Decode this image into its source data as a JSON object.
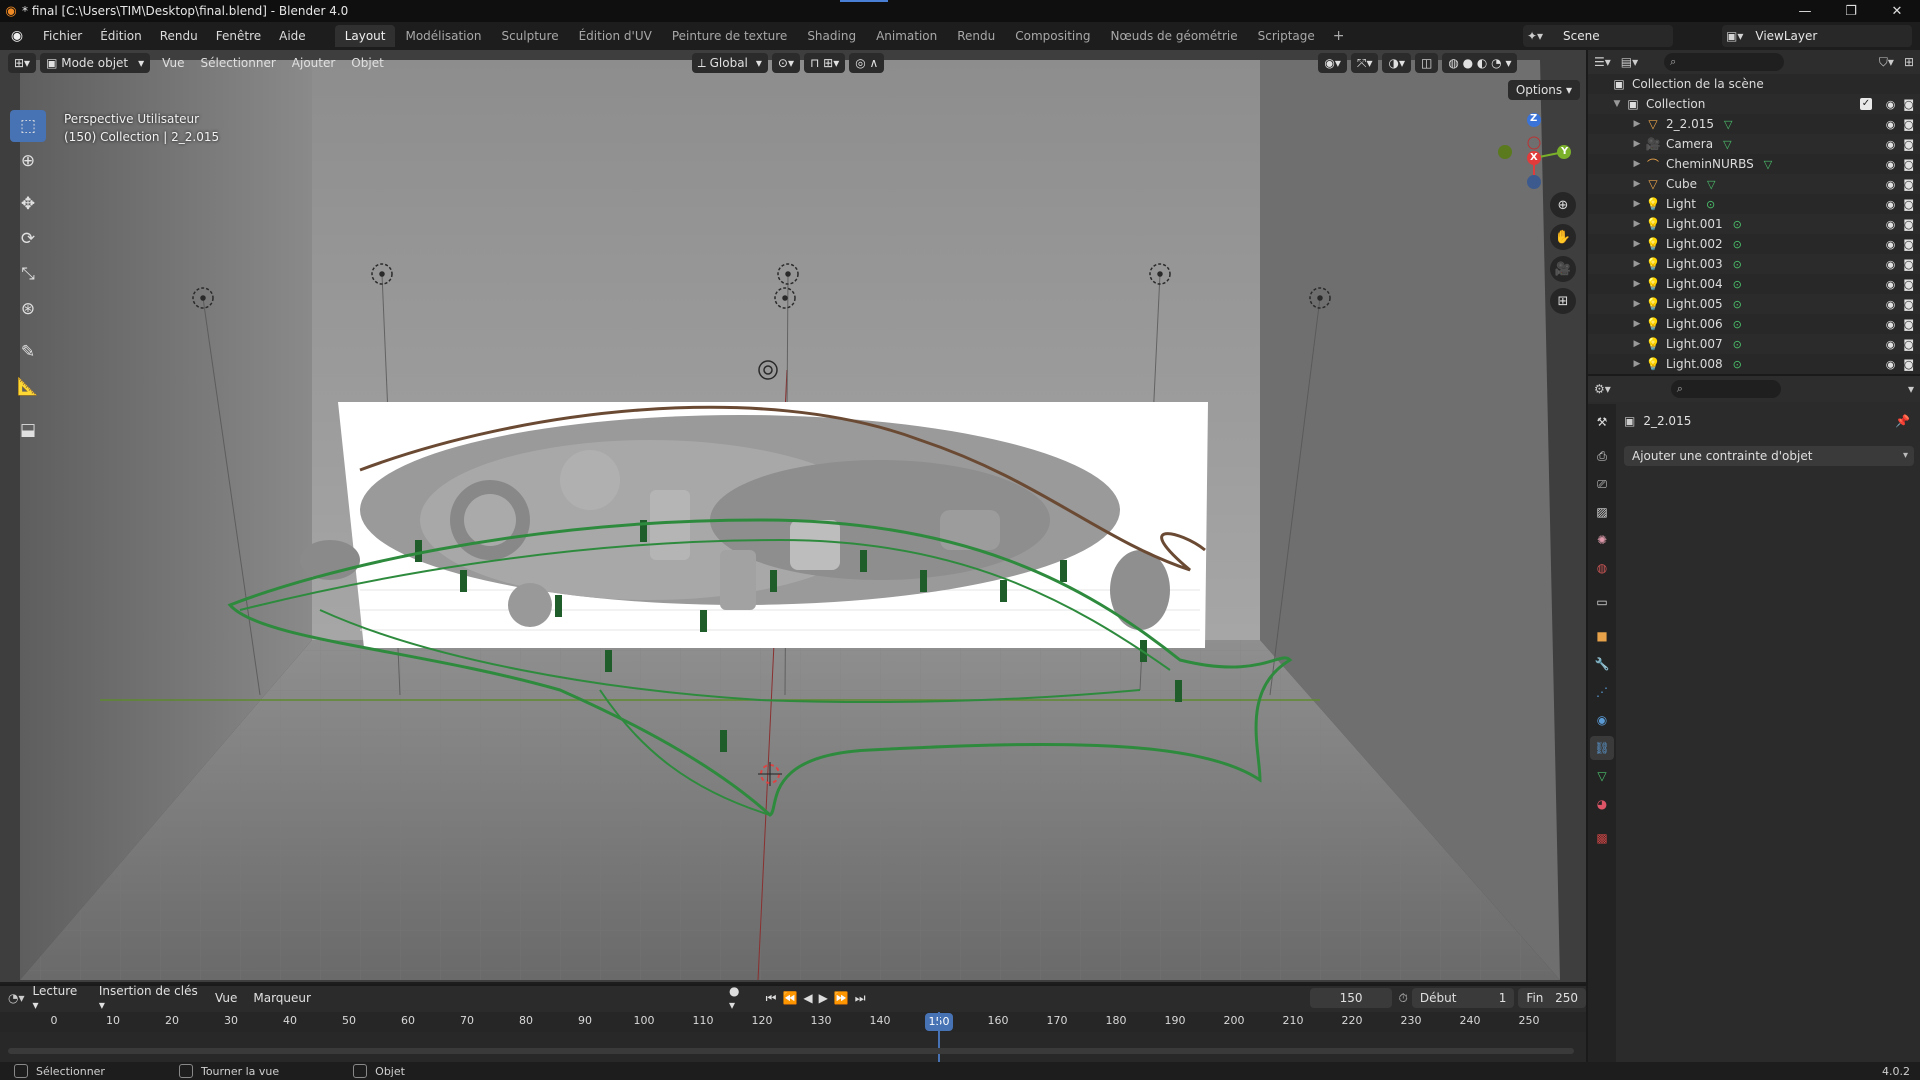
{
  "titlebar": {
    "title": "* final [C:\\Users\\TIM\\Desktop\\final.blend] - Blender 4.0"
  },
  "menubar": {
    "menus": [
      "Fichier",
      "Édition",
      "Rendu",
      "Fenêtre",
      "Aide"
    ],
    "workspaces": [
      "Layout",
      "Modélisation",
      "Sculpture",
      "Édition d'UV",
      "Peinture de texture",
      "Shading",
      "Animation",
      "Rendu",
      "Compositing",
      "Nœuds de géométrie",
      "Scriptage"
    ],
    "active_workspace": "Layout",
    "scene": "Scene",
    "view_layer": "ViewLayer"
  },
  "viewport": {
    "mode": "Mode objet",
    "menus": [
      "Vue",
      "Sélectionner",
      "Ajouter",
      "Objet"
    ],
    "transform_orientation": "Global",
    "options_label": "Options",
    "info_line1": "Perspective Utilisateur",
    "info_line2": "(150) Collection | 2_2.015",
    "gizmo": {
      "x": "X",
      "y": "Y",
      "z": "Z"
    }
  },
  "outliner": {
    "root": "Collection de la scène",
    "collection": "Collection",
    "items": [
      {
        "name": "2_2.015",
        "icon": "mesh-icon",
        "color": "#e8a34a"
      },
      {
        "name": "Camera",
        "icon": "camera-icon",
        "color": "#e8a34a"
      },
      {
        "name": "CheminNURBS",
        "icon": "curve-icon",
        "color": "#e8a34a"
      },
      {
        "name": "Cube",
        "icon": "mesh-icon",
        "color": "#e8a34a"
      },
      {
        "name": "Light",
        "icon": "light-icon",
        "color": "#e8a34a"
      },
      {
        "name": "Light.001",
        "icon": "light-icon",
        "color": "#e8a34a"
      },
      {
        "name": "Light.002",
        "icon": "light-icon",
        "color": "#e8a34a"
      },
      {
        "name": "Light.003",
        "icon": "light-icon",
        "color": "#e8a34a"
      },
      {
        "name": "Light.004",
        "icon": "light-icon",
        "color": "#e8a34a"
      },
      {
        "name": "Light.005",
        "icon": "light-icon",
        "color": "#e8a34a"
      },
      {
        "name": "Light.006",
        "icon": "light-icon",
        "color": "#e8a34a"
      },
      {
        "name": "Light.007",
        "icon": "light-icon",
        "color": "#e8a34a"
      },
      {
        "name": "Light.008",
        "icon": "light-icon",
        "color": "#e8a34a"
      }
    ]
  },
  "properties": {
    "object_name": "2_2.015",
    "add_constraint": "Ajouter une contrainte d'objet"
  },
  "timeline": {
    "playback": "Lecture",
    "keying": "Insertion de clés",
    "view": "Vue",
    "marker": "Marqueur",
    "current_frame": "150",
    "start_label": "Début",
    "start": "1",
    "end_label": "Fin",
    "end": "250",
    "ticks": [
      "0",
      "10",
      "20",
      "30",
      "40",
      "50",
      "60",
      "70",
      "80",
      "90",
      "100",
      "110",
      "120",
      "130",
      "140",
      "150",
      "160",
      "170",
      "180",
      "190",
      "200",
      "210",
      "220",
      "230",
      "240",
      "250"
    ]
  },
  "statusbar": {
    "select": "Sélectionner",
    "rotate": "Tourner la vue",
    "object": "Objet",
    "version": "4.0.2"
  },
  "colors": {
    "accent": "#4772b3",
    "curve_green": "#2e8b3e",
    "curve_brown": "#6b4a34"
  }
}
